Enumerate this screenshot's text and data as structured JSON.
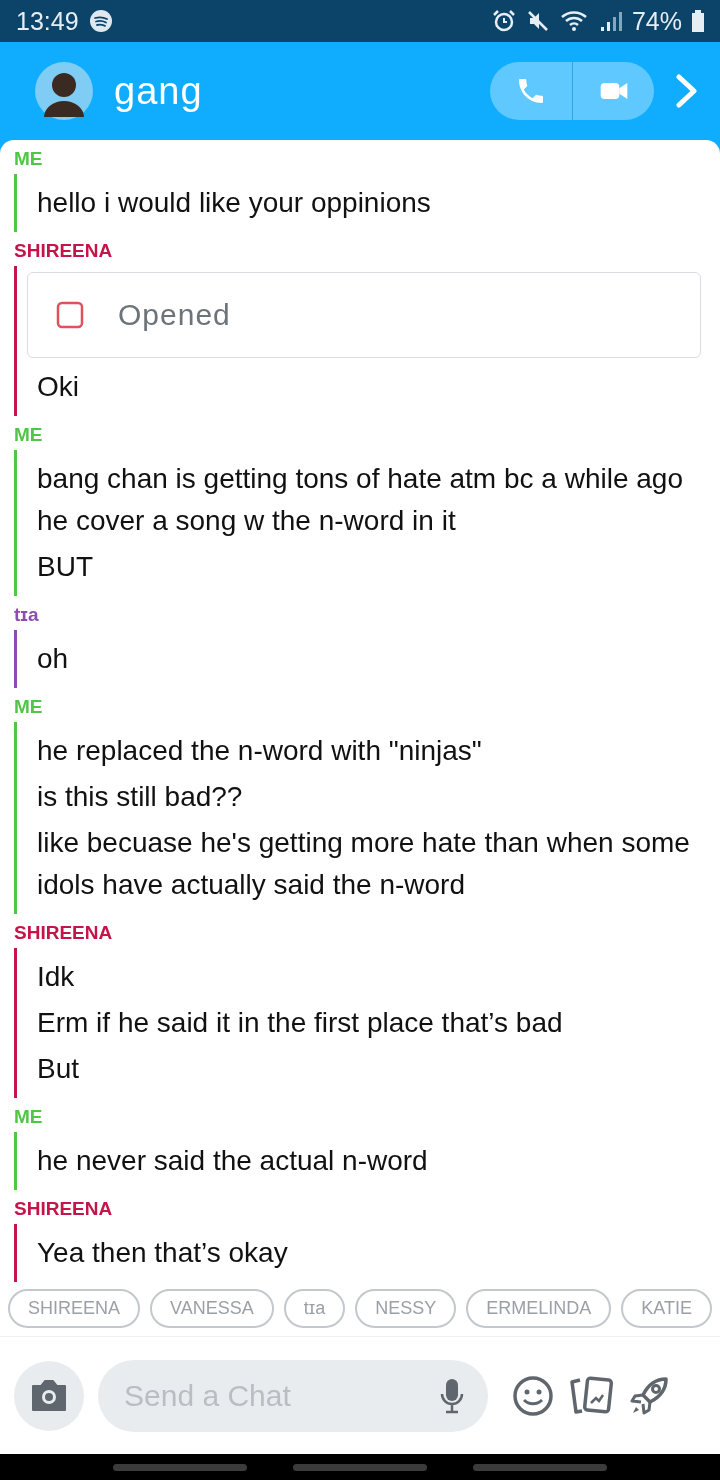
{
  "status_bar": {
    "time": "13:49",
    "battery": "74%"
  },
  "header": {
    "title": "gang"
  },
  "conversation": [
    {
      "sender": "ME",
      "color": "#4fc745",
      "messages": [
        {
          "kind": "text",
          "text": "hello i would like your oppinions"
        }
      ]
    },
    {
      "sender": "SHIREENA",
      "color": "#c4154b",
      "messages": [
        {
          "kind": "snap",
          "text": "Opened"
        },
        {
          "kind": "text",
          "text": "Oki"
        }
      ]
    },
    {
      "sender": "ME",
      "color": "#4fc745",
      "messages": [
        {
          "kind": "text",
          "text": "bang chan is getting tons of hate atm bc a while ago he cover a song w the n-word in it"
        },
        {
          "kind": "text",
          "text": "BUT"
        }
      ]
    },
    {
      "sender": "tɪa",
      "color": "#8e4bb3",
      "messages": [
        {
          "kind": "text",
          "text": "oh"
        }
      ]
    },
    {
      "sender": "ME",
      "color": "#4fc745",
      "messages": [
        {
          "kind": "text",
          "text": "he replaced the n-word with \"ninjas\""
        },
        {
          "kind": "text",
          "text": "is this still bad??"
        },
        {
          "kind": "text",
          "text": "like becuase he's getting more hate than when some idols have actually said the n-word"
        }
      ]
    },
    {
      "sender": "SHIREENA",
      "color": "#c4154b",
      "messages": [
        {
          "kind": "text",
          "text": "Idk"
        },
        {
          "kind": "text",
          "text": "Erm if he said it in the first place that’s bad"
        },
        {
          "kind": "text",
          "text": "But"
        }
      ]
    },
    {
      "sender": "ME",
      "color": "#4fc745",
      "messages": [
        {
          "kind": "text",
          "text": "he never said the actual n-word"
        }
      ]
    },
    {
      "sender": "SHIREENA",
      "color": "#c4154b",
      "messages": [
        {
          "kind": "text",
          "text": "Yea then that’s okay"
        }
      ]
    }
  ],
  "member_chips": [
    "SHIREENA",
    "VANESSA",
    "tɪa",
    "NESSY",
    "ERMELINDA",
    "KATIE"
  ],
  "composer": {
    "placeholder": "Send a Chat"
  }
}
